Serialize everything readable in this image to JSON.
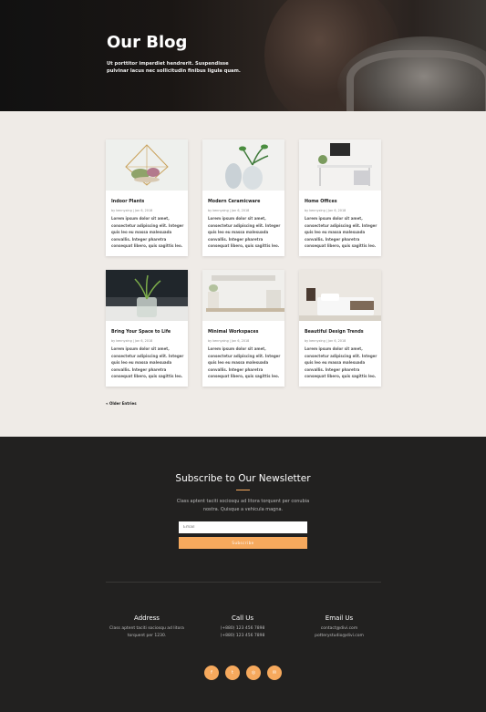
{
  "hero": {
    "title": "Our Blog",
    "subtitle": "Ut porttitor imperdiet hendrerit. Suspendisse pulvinar lacus nec sollicitudin finibus ligula quam."
  },
  "posts": [
    {
      "title": "Indoor Plants",
      "meta": "by kennyxing | Jan 6, 2018",
      "excerpt": "Lorem ipsum dolor sit amet, consectetur adipiscing elit. Integer quis leo eu massa malesuada convallis. Integer pharetra consequat libero, quis sagittis leo."
    },
    {
      "title": "Modern Ceramicware",
      "meta": "by kennyxing | Jan 6, 2018",
      "excerpt": "Lorem ipsum dolor sit amet, consectetur adipiscing elit. Integer quis leo eu massa malesuada convallis. Integer pharetra consequat libero, quis sagittis leo."
    },
    {
      "title": "Home Offices",
      "meta": "by kennyxing | Jan 6, 2018",
      "excerpt": "Lorem ipsum dolor sit amet, consectetur adipiscing elit. Integer quis leo eu massa malesuada convallis. Integer pharetra consequat libero, quis sagittis leo."
    },
    {
      "title": "Bring Your Space to Life",
      "meta": "by kennyxing | Jan 6, 2018",
      "excerpt": "Lorem ipsum dolor sit amet, consectetur adipiscing elit. Integer quis leo eu massa malesuada convallis. Integer pharetra consequat libero, quis sagittis leo."
    },
    {
      "title": "Minimal Workspaces",
      "meta": "by kennyxing | Jan 6, 2018",
      "excerpt": "Lorem ipsum dolor sit amet, consectetur adipiscing elit. Integer quis leo eu massa malesuada convallis. Integer pharetra consequat libero, quis sagittis leo."
    },
    {
      "title": "Beautiful Design Trends",
      "meta": "by kennyxing | Jan 6, 2018",
      "excerpt": "Lorem ipsum dolor sit amet, consectetur adipiscing elit. Integer quis leo eu massa malesuada convallis. Integer pharetra consequat libero, quis sagittis leo."
    }
  ],
  "pagination": {
    "older_label": "« Older Entries"
  },
  "newsletter": {
    "title": "Subscribe to Our Newsletter",
    "description": "Class aptent taciti sociosqu ad litora torquent per conubia nostra. Quisque a vehicula magna.",
    "email_placeholder": "Email",
    "button_label": "Subscribe"
  },
  "contact": {
    "address": {
      "heading": "Address",
      "lines": [
        "Class aptent taciti sociosqu ad litora",
        "torquent per 1230."
      ]
    },
    "call": {
      "heading": "Call Us",
      "lines": [
        "(+880) 123 456 7898",
        "(+880) 123 456 7898"
      ]
    },
    "email": {
      "heading": "Email Us",
      "lines": [
        "contact@divi.com",
        "potterystudio@divi.com"
      ]
    }
  },
  "social": [
    {
      "icon": "facebook-icon",
      "glyph": "f"
    },
    {
      "icon": "twitter-icon",
      "glyph": "t"
    },
    {
      "icon": "instagram-icon",
      "glyph": "◎"
    },
    {
      "icon": "email-icon",
      "glyph": "✉"
    }
  ],
  "colors": {
    "accent": "#f6a95d",
    "footer_bg": "#222120",
    "page_bg": "#efebe7"
  }
}
